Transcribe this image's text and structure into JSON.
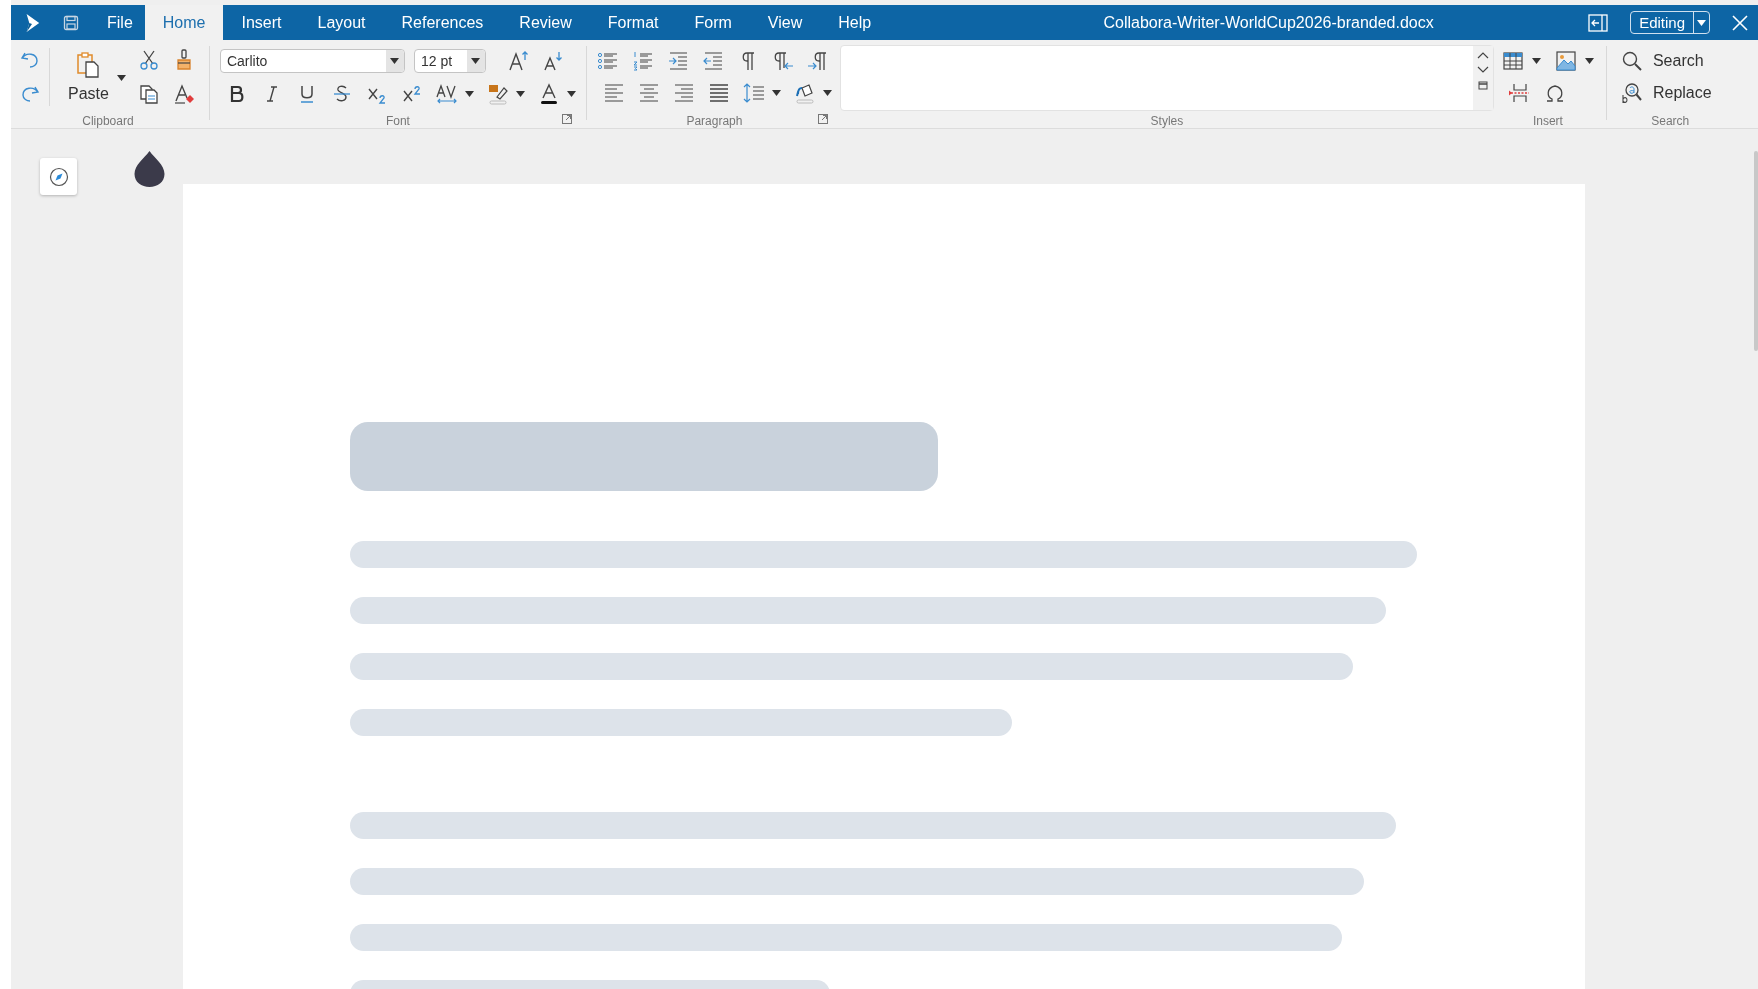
{
  "menu_tabs": [
    {
      "label": "File",
      "selected": false
    },
    {
      "label": "Home",
      "selected": true
    },
    {
      "label": "Insert",
      "selected": false
    },
    {
      "label": "Layout",
      "selected": false
    },
    {
      "label": "References",
      "selected": false
    },
    {
      "label": "Review",
      "selected": false
    },
    {
      "label": "Format",
      "selected": false
    },
    {
      "label": "Form",
      "selected": false
    },
    {
      "label": "View",
      "selected": false
    },
    {
      "label": "Help",
      "selected": false
    }
  ],
  "document_title": "Collabora-Writer-WorldCup2026-branded.docx",
  "mode_button": "Editing",
  "ribbon": {
    "paste": "Paste",
    "font_name": "Carlito",
    "font_size": "12 pt",
    "search": "Search",
    "replace": "Replace",
    "group_labels": [
      "Clipboard",
      "Font",
      "Paragraph",
      "Styles",
      "Insert",
      "Search"
    ]
  }
}
